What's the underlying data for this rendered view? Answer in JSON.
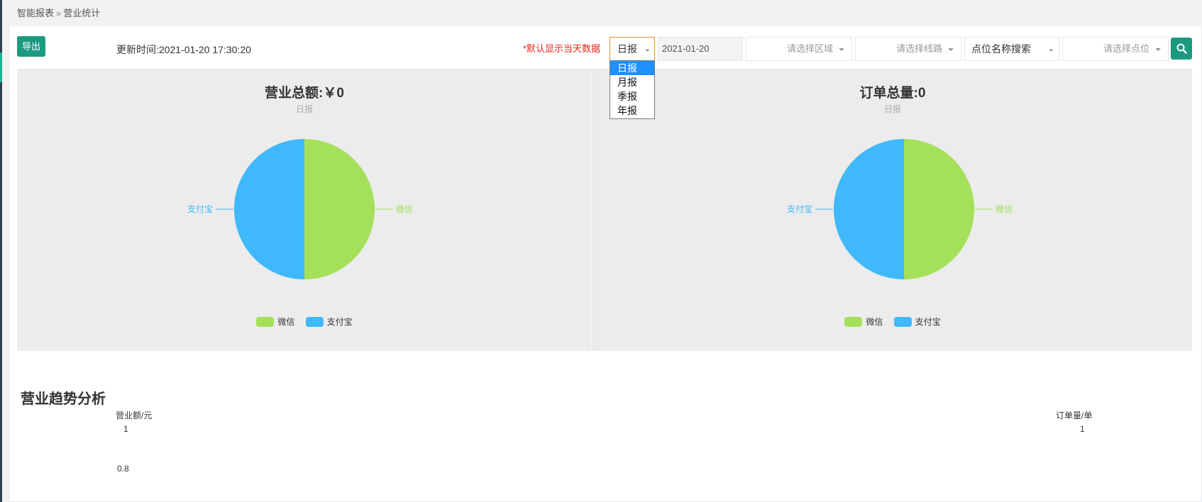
{
  "breadcrumb": {
    "parent": "智能报表",
    "separator": "»",
    "current": "营业统计"
  },
  "toolbar": {
    "export_label": "导出",
    "update_time": "更新时间:2021-01-20 17:30:20",
    "default_note": "*默认显示当天数据",
    "report_type": "日报",
    "date_value": "2021-01-20",
    "area_placeholder": "请选择区域",
    "line_placeholder": "请选择线路",
    "site_search": "点位名称搜索",
    "point_placeholder": "请选择点位",
    "report_options": [
      "日报",
      "月报",
      "季报",
      "年报"
    ]
  },
  "icons": {
    "search": "search-icon",
    "caret": "chevron-down-icon"
  },
  "colors": {
    "wechat": "#a5e05a",
    "alipay": "#3fb9fb",
    "accent": "#1c9a80",
    "note": "#e4261c"
  },
  "charts": [
    {
      "title": "营业总额:￥0",
      "subtitle": "日报",
      "slices": [
        {
          "name": "微信",
          "value": 0
        },
        {
          "name": "支付宝",
          "value": 0
        }
      ],
      "legend": [
        "微信",
        "支付宝"
      ]
    },
    {
      "title": "订单总量:0",
      "subtitle": "日报",
      "slices": [
        {
          "name": "微信",
          "value": 0
        },
        {
          "name": "支付宝",
          "value": 0
        }
      ],
      "legend": [
        "微信",
        "支付宝"
      ]
    }
  ],
  "chart_data": [
    {
      "type": "pie",
      "title": "营业总额:￥0",
      "subtitle": "日报",
      "labels": [
        "微信",
        "支付宝"
      ],
      "values": [
        0,
        0
      ],
      "legend_position": "bottom"
    },
    {
      "type": "pie",
      "title": "订单总量:0",
      "subtitle": "日报",
      "labels": [
        "微信",
        "支付宝"
      ],
      "values": [
        0,
        0
      ],
      "legend_position": "bottom"
    },
    {
      "type": "line",
      "title": "营业趋势分析",
      "ylabel_left": "营业额/元",
      "ylabel_right": "订单量/单",
      "yticks_left": [
        "1",
        "0.8"
      ],
      "yticks_right": [
        "1"
      ]
    }
  ],
  "trend": {
    "title": "营业趋势分析",
    "ylabel_left": "营业额/元",
    "ylabel_right": "订单量/单",
    "left_ticks": [
      "1",
      "0.8"
    ],
    "right_tick": "1"
  }
}
